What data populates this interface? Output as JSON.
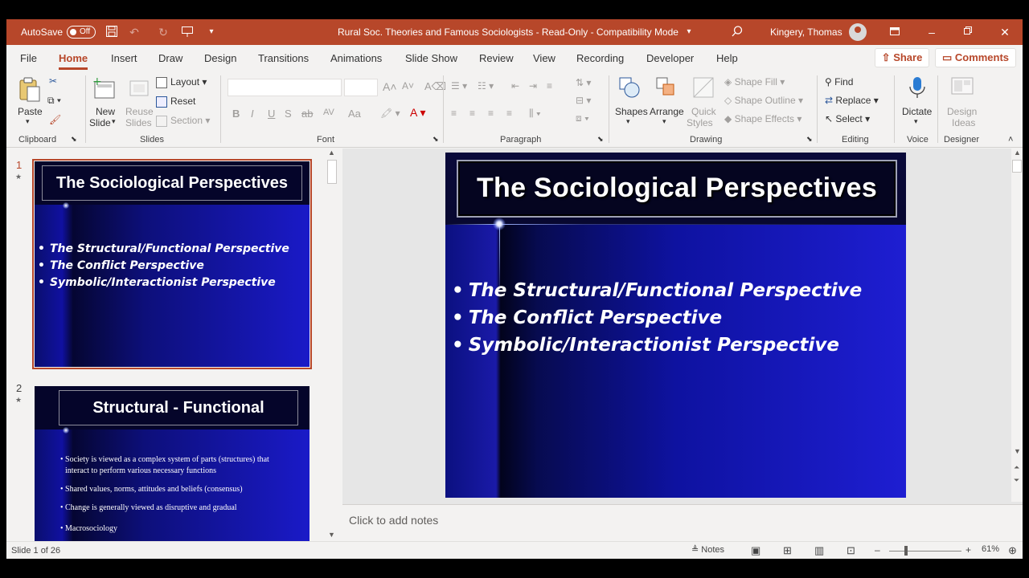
{
  "titlebar": {
    "autosave_label": "AutoSave",
    "autosave_state": "Off",
    "document_title": "Rural Soc. Theories and Famous Sociologists  -  Read-Only  -  Compatibility Mode",
    "user_name": "Kingery, Thomas"
  },
  "tabs": [
    "File",
    "Home",
    "Insert",
    "Draw",
    "Design",
    "Transitions",
    "Animations",
    "Slide Show",
    "Review",
    "View",
    "Recording",
    "Developer",
    "Help"
  ],
  "active_tab": "Home",
  "share_label": "Share",
  "comments_label": "Comments",
  "ribbon": {
    "clipboard": {
      "paste": "Paste",
      "label": "Clipboard"
    },
    "slides": {
      "new_slide_1": "New",
      "new_slide_2": "Slide",
      "reuse_1": "Reuse",
      "reuse_2": "Slides",
      "layout": "Layout",
      "reset": "Reset",
      "section": "Section",
      "label": "Slides"
    },
    "font": {
      "label": "Font",
      "buttons": [
        "B",
        "I",
        "U",
        "S",
        "ab",
        "AV",
        "Aa"
      ]
    },
    "paragraph": {
      "label": "Paragraph"
    },
    "drawing": {
      "shapes": "Shapes",
      "arrange": "Arrange",
      "quick_1": "Quick",
      "quick_2": "Styles",
      "shape_fill": "Shape Fill",
      "shape_outline": "Shape Outline",
      "shape_effects": "Shape Effects",
      "label": "Drawing"
    },
    "editing": {
      "find": "Find",
      "replace": "Replace",
      "select": "Select",
      "label": "Editing"
    },
    "voice": {
      "dictate": "Dictate",
      "label": "Voice"
    },
    "designer": {
      "design_1": "Design",
      "design_2": "Ideas",
      "label": "Designer"
    }
  },
  "thumbnails": [
    {
      "number": "1",
      "title": "The Sociological Perspectives",
      "bullets": [
        "The Structural/Functional Perspective",
        "The Conflict Perspective",
        "Symbolic/Interactionist Perspective"
      ]
    },
    {
      "number": "2",
      "title": "Structural - Functional",
      "bullets": [
        "Society is viewed as a complex system of parts (structures) that",
        "interact to perform various necessary functions",
        "Shared values, norms, attitudes and beliefs (consensus)",
        "Change is generally viewed as disruptive and gradual",
        "Macrosociology"
      ]
    }
  ],
  "current_slide": {
    "title": "The Sociological Perspectives",
    "bullets": [
      "The Structural/Functional Perspective",
      "The Conflict Perspective",
      "Symbolic/Interactionist Perspective"
    ]
  },
  "notes_placeholder": "Click to add notes",
  "statusbar": {
    "slide_count": "Slide 1 of 26",
    "notes_label": "Notes",
    "zoom": "61%"
  }
}
